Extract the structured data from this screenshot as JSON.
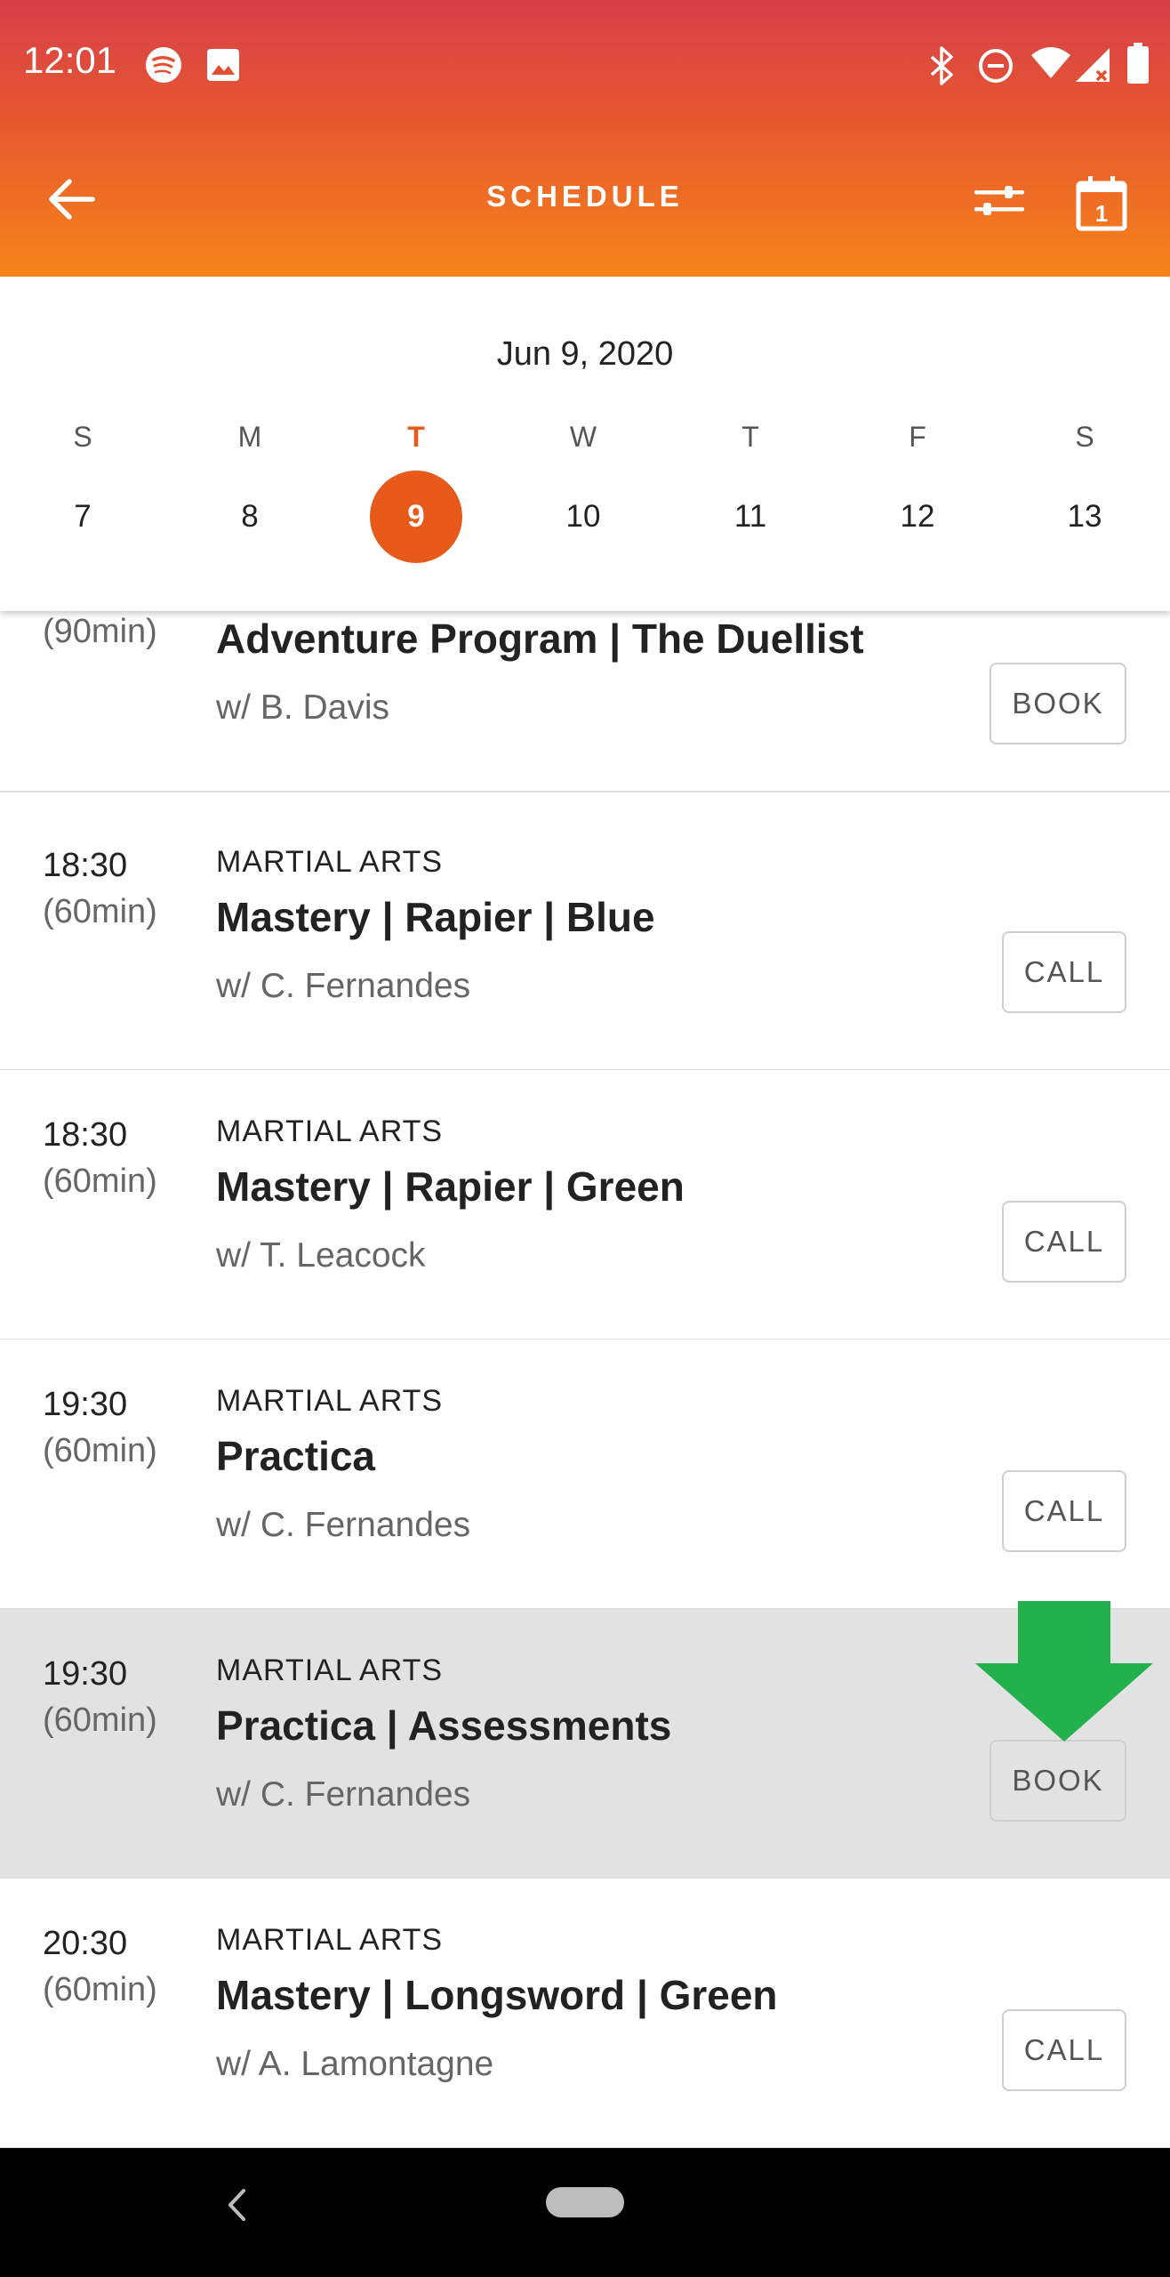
{
  "status_bar": {
    "time": "12:01",
    "left_icons": [
      "spotify-icon",
      "image-icon"
    ],
    "right_icons": [
      "bluetooth-icon",
      "do-not-disturb-icon",
      "wifi-icon",
      "signal-icon",
      "battery-icon"
    ]
  },
  "app_bar": {
    "title": "SCHEDULE",
    "back_icon": "arrow-left-icon",
    "filter_icon": "sliders-icon",
    "calendar_icon": "calendar-icon",
    "calendar_day": "1"
  },
  "date_picker": {
    "date_label": "Jun 9, 2020",
    "weekdays": [
      "S",
      "M",
      "T",
      "W",
      "T",
      "F",
      "S"
    ],
    "days": [
      "7",
      "8",
      "9",
      "10",
      "11",
      "12",
      "13"
    ],
    "selected_day": "9",
    "accent_color": "#e75a1a"
  },
  "classes": [
    {
      "time": "",
      "duration": "(90min)",
      "category": "",
      "title": "Adventure Program | The Duellist",
      "instructor": "w/ B. Davis",
      "action": "BOOK"
    },
    {
      "time": "18:30",
      "duration": "(60min)",
      "category": "MARTIAL ARTS",
      "title": "Mastery | Rapier | Blue",
      "instructor": "w/ C. Fernandes",
      "action": "CALL"
    },
    {
      "time": "18:30",
      "duration": "(60min)",
      "category": "MARTIAL ARTS",
      "title": "Mastery | Rapier | Green",
      "instructor": "w/ T. Leacock",
      "action": "CALL"
    },
    {
      "time": "19:30",
      "duration": "(60min)",
      "category": "MARTIAL ARTS",
      "title": "Practica",
      "instructor": "w/ C. Fernandes",
      "action": "CALL"
    },
    {
      "time": "19:30",
      "duration": "(60min)",
      "category": "MARTIAL ARTS",
      "title": "Practica | Assessments",
      "instructor": "w/ C. Fernandes",
      "action": "BOOK"
    },
    {
      "time": "20:30",
      "duration": "(60min)",
      "category": "MARTIAL ARTS",
      "title": "Mastery | Longsword | Green",
      "instructor": "w/ A. Lamontagne",
      "action": "CALL"
    }
  ],
  "annotation": {
    "icon": "arrow-down-icon",
    "color": "#22b14c"
  },
  "nav_bar": {
    "back_icon": "chevron-left-icon",
    "home_icon": "home-pill-icon"
  }
}
